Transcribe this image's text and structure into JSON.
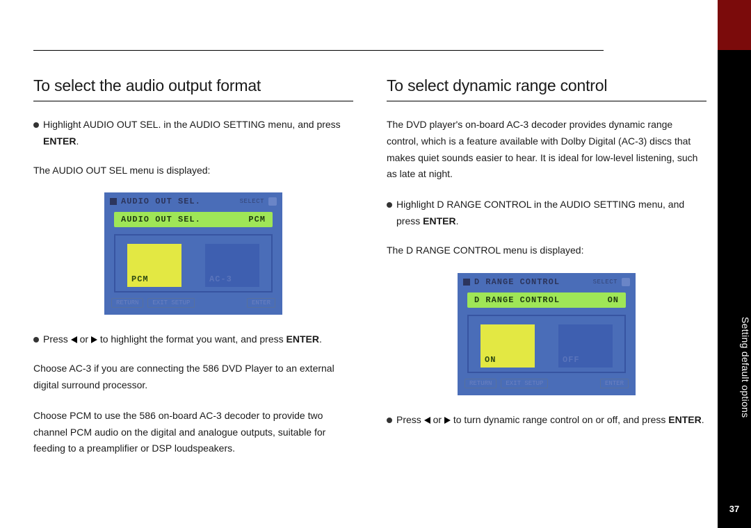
{
  "side": {
    "section": "Setting default options",
    "page": "37"
  },
  "left": {
    "heading": "To select the audio output format",
    "step1": {
      "a": "Highlight AUDIO OUT SEL. in the AUDIO SETTING menu, and press ",
      "b": "ENTER",
      "c": "."
    },
    "displayed": "The AUDIO OUT SEL menu is displayed:",
    "osd": {
      "title": "AUDIO OUT SEL.",
      "sub": "SELECT",
      "row_label": "AUDIO OUT SEL.",
      "row_value": "PCM",
      "opts": [
        "PCM",
        "AC-3"
      ],
      "footer": [
        "RETURN",
        "EXIT  SETUP",
        "ENTER"
      ]
    },
    "step2": {
      "a": "Press ",
      "b": " or ",
      "c": " to highlight the format you want, and press ",
      "d": "ENTER",
      "e": "."
    },
    "note_ac3": "Choose AC-3 if you are connecting the 586 DVD Player to an external digital surround processor.",
    "note_pcm": "Choose PCM to use the 586 on-board AC-3 decoder to provide two channel PCM audio on the digital and analogue outputs, suitable for feeding to a preamplifier or DSP loudspeakers."
  },
  "right": {
    "heading": "To select dynamic range control",
    "intro": "The DVD player's on-board AC-3 decoder provides dynamic range control, which is a feature available with Dolby Digital (AC-3) discs that makes quiet sounds easier to hear. It is ideal for low-level listening, such as late at night.",
    "step1": {
      "a": "Highlight D RANGE CONTROL in the AUDIO SETTING menu, and press ",
      "b": "ENTER",
      "c": "."
    },
    "displayed": "The D RANGE CONTROL menu is displayed:",
    "osd": {
      "title": "D RANGE CONTROL",
      "sub": "SELECT",
      "row_label": "D RANGE CONTROL",
      "row_value": "ON",
      "opts": [
        "ON",
        "OFF"
      ],
      "footer": [
        "RETURN",
        "EXIT  SETUP",
        "ENTER"
      ]
    },
    "step2": {
      "a": "Press ",
      "b": " or ",
      "c": " to turn dynamic range control on or off, and press ",
      "d": "ENTER",
      "e": "."
    }
  }
}
